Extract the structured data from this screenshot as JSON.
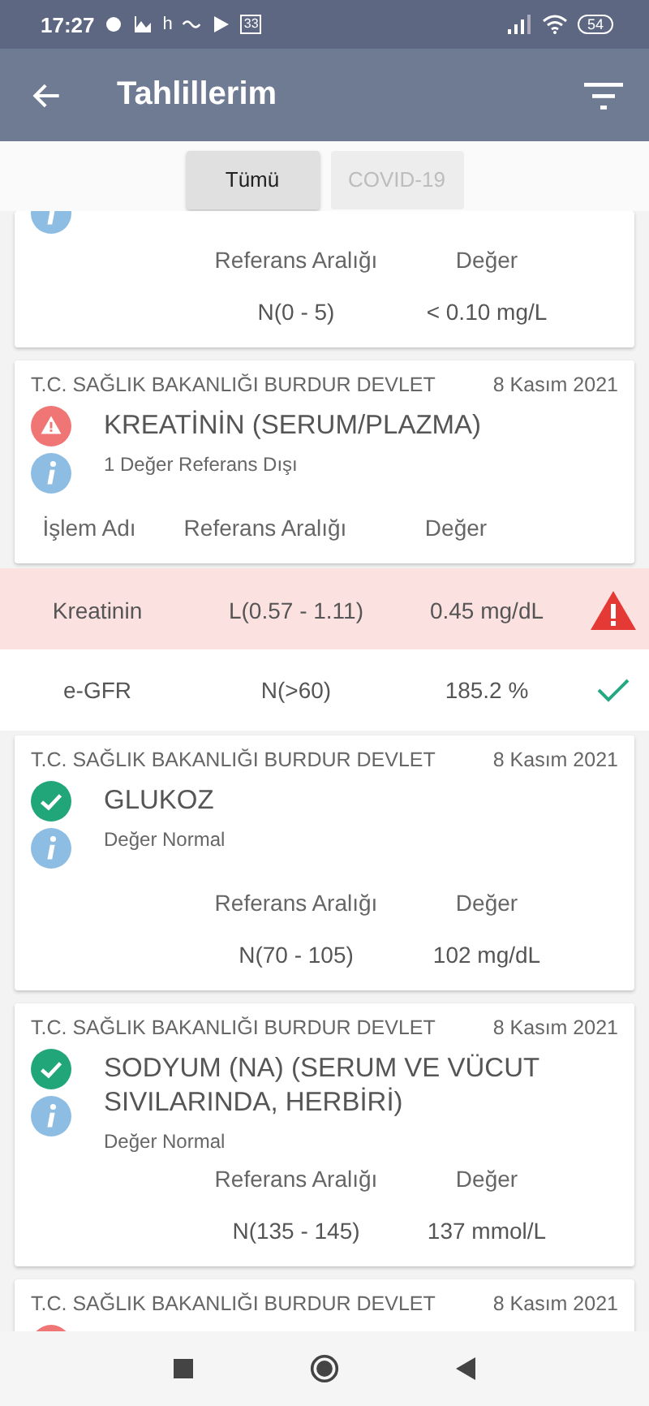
{
  "status_bar": {
    "time": "17:27",
    "notification_letter": "h",
    "calendar_day": "33",
    "battery": "54"
  },
  "app_bar": {
    "title": "Tahlillerim"
  },
  "tabs": [
    {
      "label": "Tümü",
      "selected": true
    },
    {
      "label": "COVID-19",
      "selected": false
    }
  ],
  "results": [
    {
      "kind": "single",
      "columns": [
        "Referans Aralığı",
        "Değer"
      ],
      "rows": [
        {
          "range": "N(0 - 5)",
          "value": "< 0.10 mg/L"
        }
      ]
    },
    {
      "kind": "multi",
      "hospital": "T.C. SAĞLIK BAKANLIĞI BURDUR DEVLET",
      "date": "8 Kasım 2021",
      "title": "KREATİNİN (SERUM/PLAZMA)",
      "abnormal": true,
      "summary": "1 Değer Referans Dışı",
      "columns": [
        "İşlem Adı",
        "Referans Aralığı",
        "Değer"
      ],
      "rows": [
        {
          "name": "Kreatinin",
          "range": "L(0.57 - 1.11)",
          "value": "0.45 mg/dL",
          "out_of_range": true
        },
        {
          "name": "e-GFR",
          "range": "N(>60)",
          "value": "185.2 %",
          "out_of_range": false
        }
      ]
    },
    {
      "kind": "single",
      "hospital": "T.C. SAĞLIK BAKANLIĞI BURDUR DEVLET",
      "date": "8 Kasım 2021",
      "title": "GLUKOZ",
      "abnormal": false,
      "summary": "Değer Normal",
      "columns": [
        "Referans Aralığı",
        "Değer"
      ],
      "rows": [
        {
          "range": "N(70 - 105)",
          "value": "102 mg/dL"
        }
      ]
    },
    {
      "kind": "single",
      "hospital": "T.C. SAĞLIK BAKANLIĞI BURDUR DEVLET",
      "date": "8 Kasım 2021",
      "title": "SODYUM (NA) (SERUM VE VÜCUT SIVILARINDA, HERBİRİ)",
      "abnormal": false,
      "summary": "Değer Normal",
      "columns": [
        "Referans Aralığı",
        "Değer"
      ],
      "rows": [
        {
          "range": "N(135 - 145)",
          "value": "137 mmol/L"
        }
      ]
    },
    {
      "kind": "single",
      "hospital": "T.C. SAĞLIK BAKANLIĞI BURDUR DEVLET",
      "date": "8 Kasım 2021",
      "abnormal": true
    }
  ]
}
